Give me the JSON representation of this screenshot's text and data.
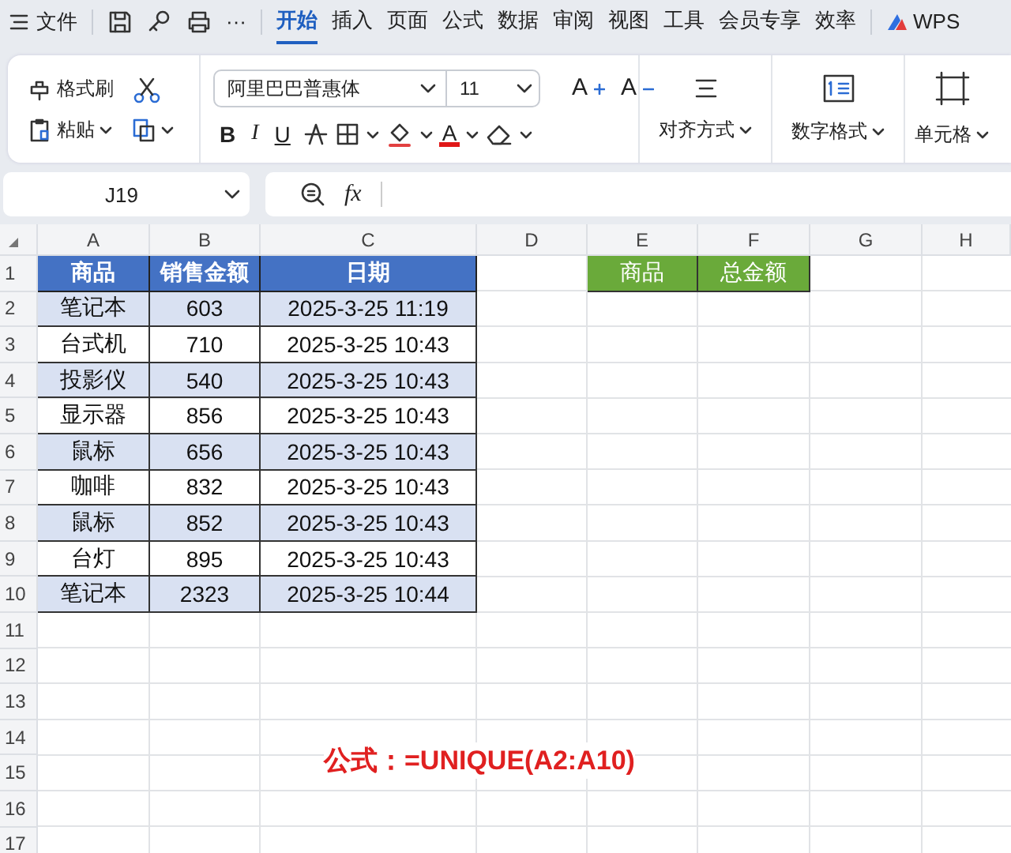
{
  "menu": {
    "label": "文件",
    "more": "···"
  },
  "tabs": [
    {
      "label": "开始",
      "selected": true
    },
    {
      "label": "插入",
      "selected": false
    },
    {
      "label": "页面",
      "selected": false
    },
    {
      "label": "公式",
      "selected": false
    },
    {
      "label": "数据",
      "selected": false
    },
    {
      "label": "审阅",
      "selected": false
    },
    {
      "label": "视图",
      "selected": false
    },
    {
      "label": "工具",
      "selected": false
    },
    {
      "label": "会员专享",
      "selected": false
    },
    {
      "label": "效率",
      "selected": false
    }
  ],
  "brand": "WPS",
  "ribbon": {
    "format_painter": "格式刷",
    "paste": "粘贴",
    "font": "阿里巴巴普惠体",
    "size": "11",
    "grow": "A",
    "shrink": "A",
    "bold": "B",
    "italic": "I",
    "underline": "U",
    "font_color": "A",
    "align": "对齐方式",
    "number_format": "数字格式",
    "cell": "单元格"
  },
  "formula_bar": {
    "name_box": "J19",
    "fx": "fx"
  },
  "columns": [
    "A",
    "B",
    "C",
    "D",
    "E",
    "F",
    "G",
    "H"
  ],
  "row_numbers": [
    "1",
    "2",
    "3",
    "4",
    "5",
    "6",
    "7",
    "8",
    "9",
    "10",
    "11",
    "12",
    "13",
    "14",
    "15",
    "16",
    "17"
  ],
  "table": {
    "headers": [
      "商品",
      "销售金额",
      "日期"
    ],
    "rows": [
      [
        "笔记本",
        "603",
        "2025-3-25 11:19"
      ],
      [
        "台式机",
        "710",
        "2025-3-25 10:43"
      ],
      [
        "投影仪",
        "540",
        "2025-3-25 10:43"
      ],
      [
        "显示器",
        "856",
        "2025-3-25 10:43"
      ],
      [
        "鼠标",
        "656",
        "2025-3-25 10:43"
      ],
      [
        "咖啡",
        "832",
        "2025-3-25 10:43"
      ],
      [
        "鼠标",
        "852",
        "2025-3-25 10:43"
      ],
      [
        "台灯",
        "895",
        "2025-3-25 10:43"
      ],
      [
        "笔记本",
        "2323",
        "2025-3-25 10:44"
      ]
    ]
  },
  "result_headers": [
    "商品",
    "总金额"
  ],
  "annotation": "公式：=UNIQUE(A2:A10)"
}
